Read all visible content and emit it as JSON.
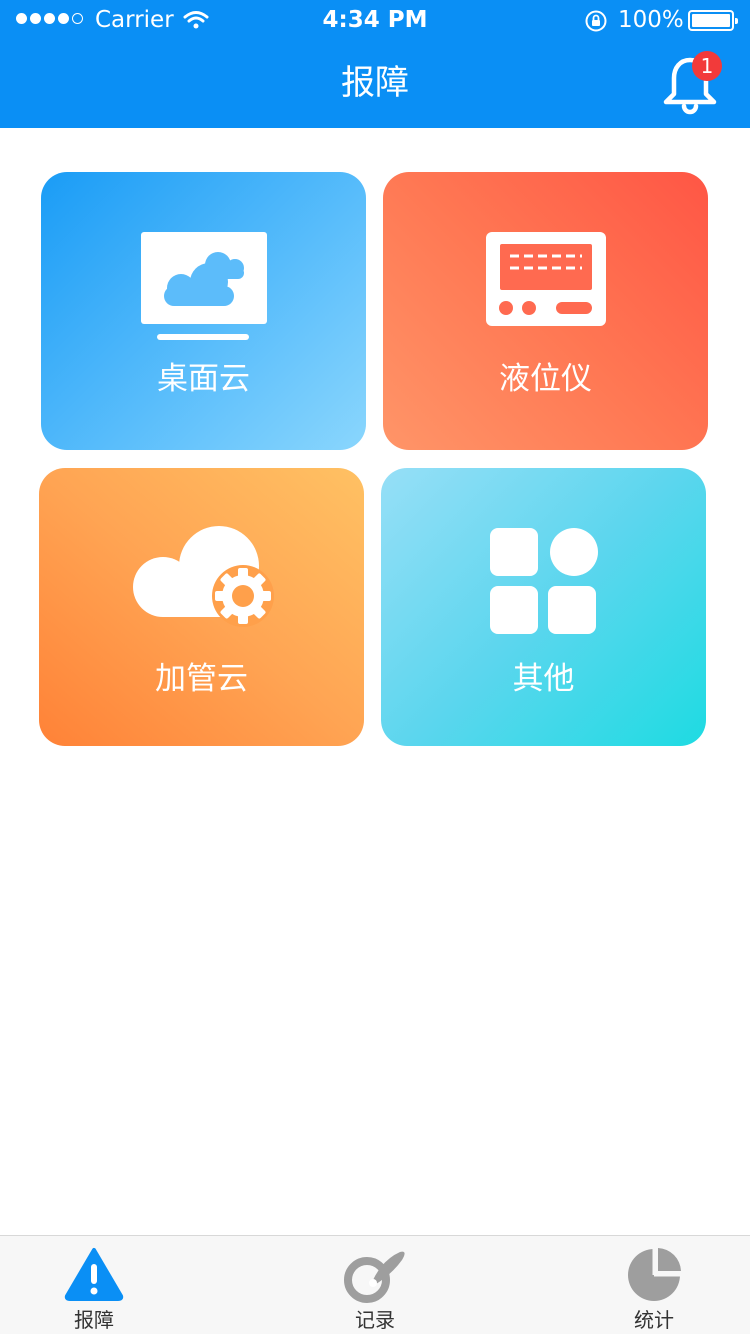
{
  "status_bar": {
    "carrier": "Carrier",
    "time": "4:34 PM",
    "battery": "100%",
    "signal_bars": 4,
    "signal_total": 5
  },
  "header": {
    "title": "报障",
    "notification_count": "1",
    "bell_icon": "bell-icon",
    "background": "#0a8ff5"
  },
  "tiles": [
    {
      "label": "桌面云",
      "icon": "desktop-cloud-icon"
    },
    {
      "label": "液位仪",
      "icon": "level-meter-icon"
    },
    {
      "label": "加管云",
      "icon": "cloud-gear-icon"
    },
    {
      "label": "其他",
      "icon": "apps-grid-icon"
    }
  ],
  "tabbar": {
    "tabs": [
      {
        "label": "报障",
        "icon": "warning-icon",
        "active": true
      },
      {
        "label": "记录",
        "icon": "record-icon",
        "active": false
      },
      {
        "label": "统计",
        "icon": "pie-chart-icon",
        "active": false
      }
    ],
    "active_color": "#0a8ff5",
    "inactive_color": "#9e9e9e"
  }
}
